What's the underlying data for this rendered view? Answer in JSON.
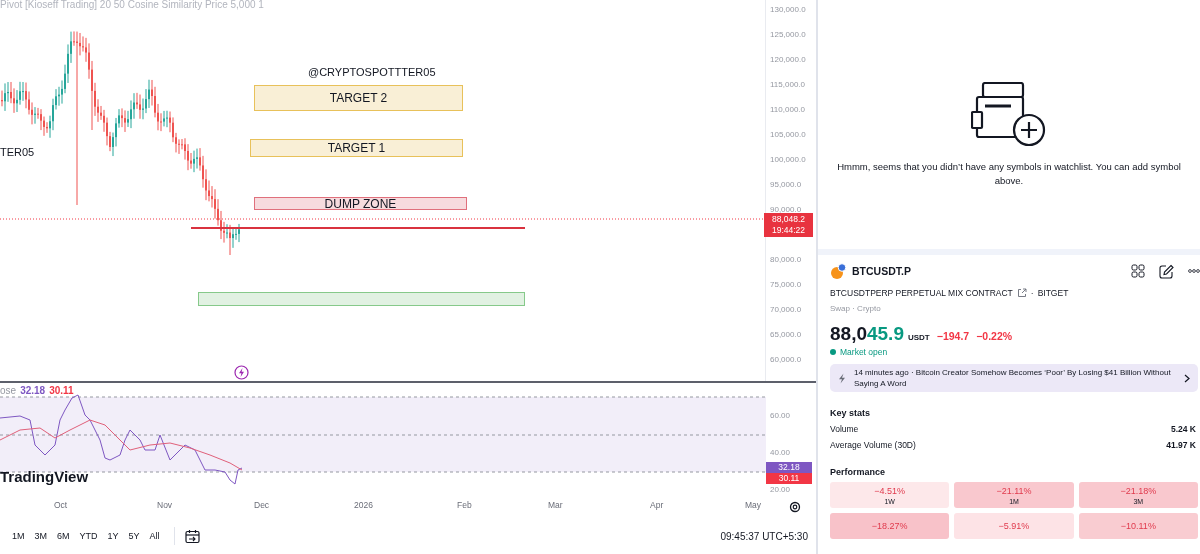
{
  "chart": {
    "indicator_title": "Pivot [Kioseff Trading] 20 50 Cosine Similarity Price 5,000 1",
    "watermark_left": "TER05",
    "price_axis": [
      "130,000.0",
      "125,000.0",
      "120,000.0",
      "115,000.0",
      "110,000.0",
      "105,000.0",
      "100,000.0",
      "95,000.0",
      "90,000.0",
      "80,000.0",
      "75,000.0",
      "70,000.0",
      "65,000.0",
      "60,000.0"
    ],
    "last_price": {
      "price": "88,048.2",
      "countdown": "19:44:22"
    },
    "annotations": [
      {
        "kind": "text",
        "text": "@CRYPTOSPOTTTER05"
      },
      {
        "kind": "zone",
        "label": "TARGET 2",
        "color": "#e8c15a"
      },
      {
        "kind": "zone",
        "label": "TARGET 1",
        "color": "#e8c15a"
      },
      {
        "kind": "zone",
        "label": "DUMP ZONE",
        "color": "#e0707c"
      },
      {
        "kind": "line",
        "color": "#d9323f"
      },
      {
        "kind": "zone",
        "color": "#86c98a"
      }
    ],
    "rsi": {
      "legend_label": "ose",
      "legend_values": [
        {
          "text": "32.18",
          "color": "#7e57c2"
        },
        {
          "text": "30.11",
          "color": "#f23645"
        }
      ],
      "axis": [
        "60.00",
        "40.00",
        "20.00"
      ],
      "badges": [
        {
          "text": "32.18",
          "color": "#7e57c2"
        },
        {
          "text": "30.11",
          "color": "#f23645"
        }
      ]
    },
    "logo": "TradingView",
    "time_axis": [
      "Oct",
      "Nov",
      "Dec",
      "2026",
      "Feb",
      "Mar",
      "Apr",
      "May"
    ],
    "ranges": [
      "1M",
      "3M",
      "6M",
      "YTD",
      "1Y",
      "5Y",
      "All"
    ],
    "clock": "09:45:37 UTC+5:30"
  },
  "watchlist": {
    "empty_message": "Hmmm, seems that you didn’t have any symbols in watchlist. You can add symbol above."
  },
  "symbol": {
    "ticker": "BTCUSDT.P",
    "description": "BTCUSDTPERP PERPETUAL MIX CONTRACT",
    "exchange_separator": "·",
    "exchange": "BITGET",
    "category": "Swap · Crypto",
    "price_main": "88,0",
    "price_tail": "45.9",
    "currency": "USDT",
    "change": "−194.7",
    "change_percent": "−0.22%",
    "market_status": "Market open",
    "news": {
      "time": "14 minutes ago",
      "separator": "·",
      "headline": "Bitcoin Creator Somehow Becomes ‘Poor’ By Losing $41 Billion Without Saying A Word"
    },
    "key_stats_title": "Key stats",
    "key_stats": [
      {
        "label": "Volume",
        "value": "5.24 K"
      },
      {
        "label": "Average Volume (30D)",
        "value": "41.97 K"
      }
    ],
    "performance_title": "Performance",
    "performance": [
      {
        "change": "−4.51%",
        "period": "1W",
        "color": "#fde8ea"
      },
      {
        "change": "−21.11%",
        "period": "1M",
        "color": "#f9c8ce"
      },
      {
        "change": "−21.18%",
        "period": "3M",
        "color": "#f9c8ce"
      },
      {
        "change": "−18.27%",
        "color": "#f8c2c9"
      },
      {
        "change": "−5.91%",
        "color": "#fde3e6"
      },
      {
        "change": "−10.11%",
        "color": "#f9ccd1"
      }
    ]
  }
}
